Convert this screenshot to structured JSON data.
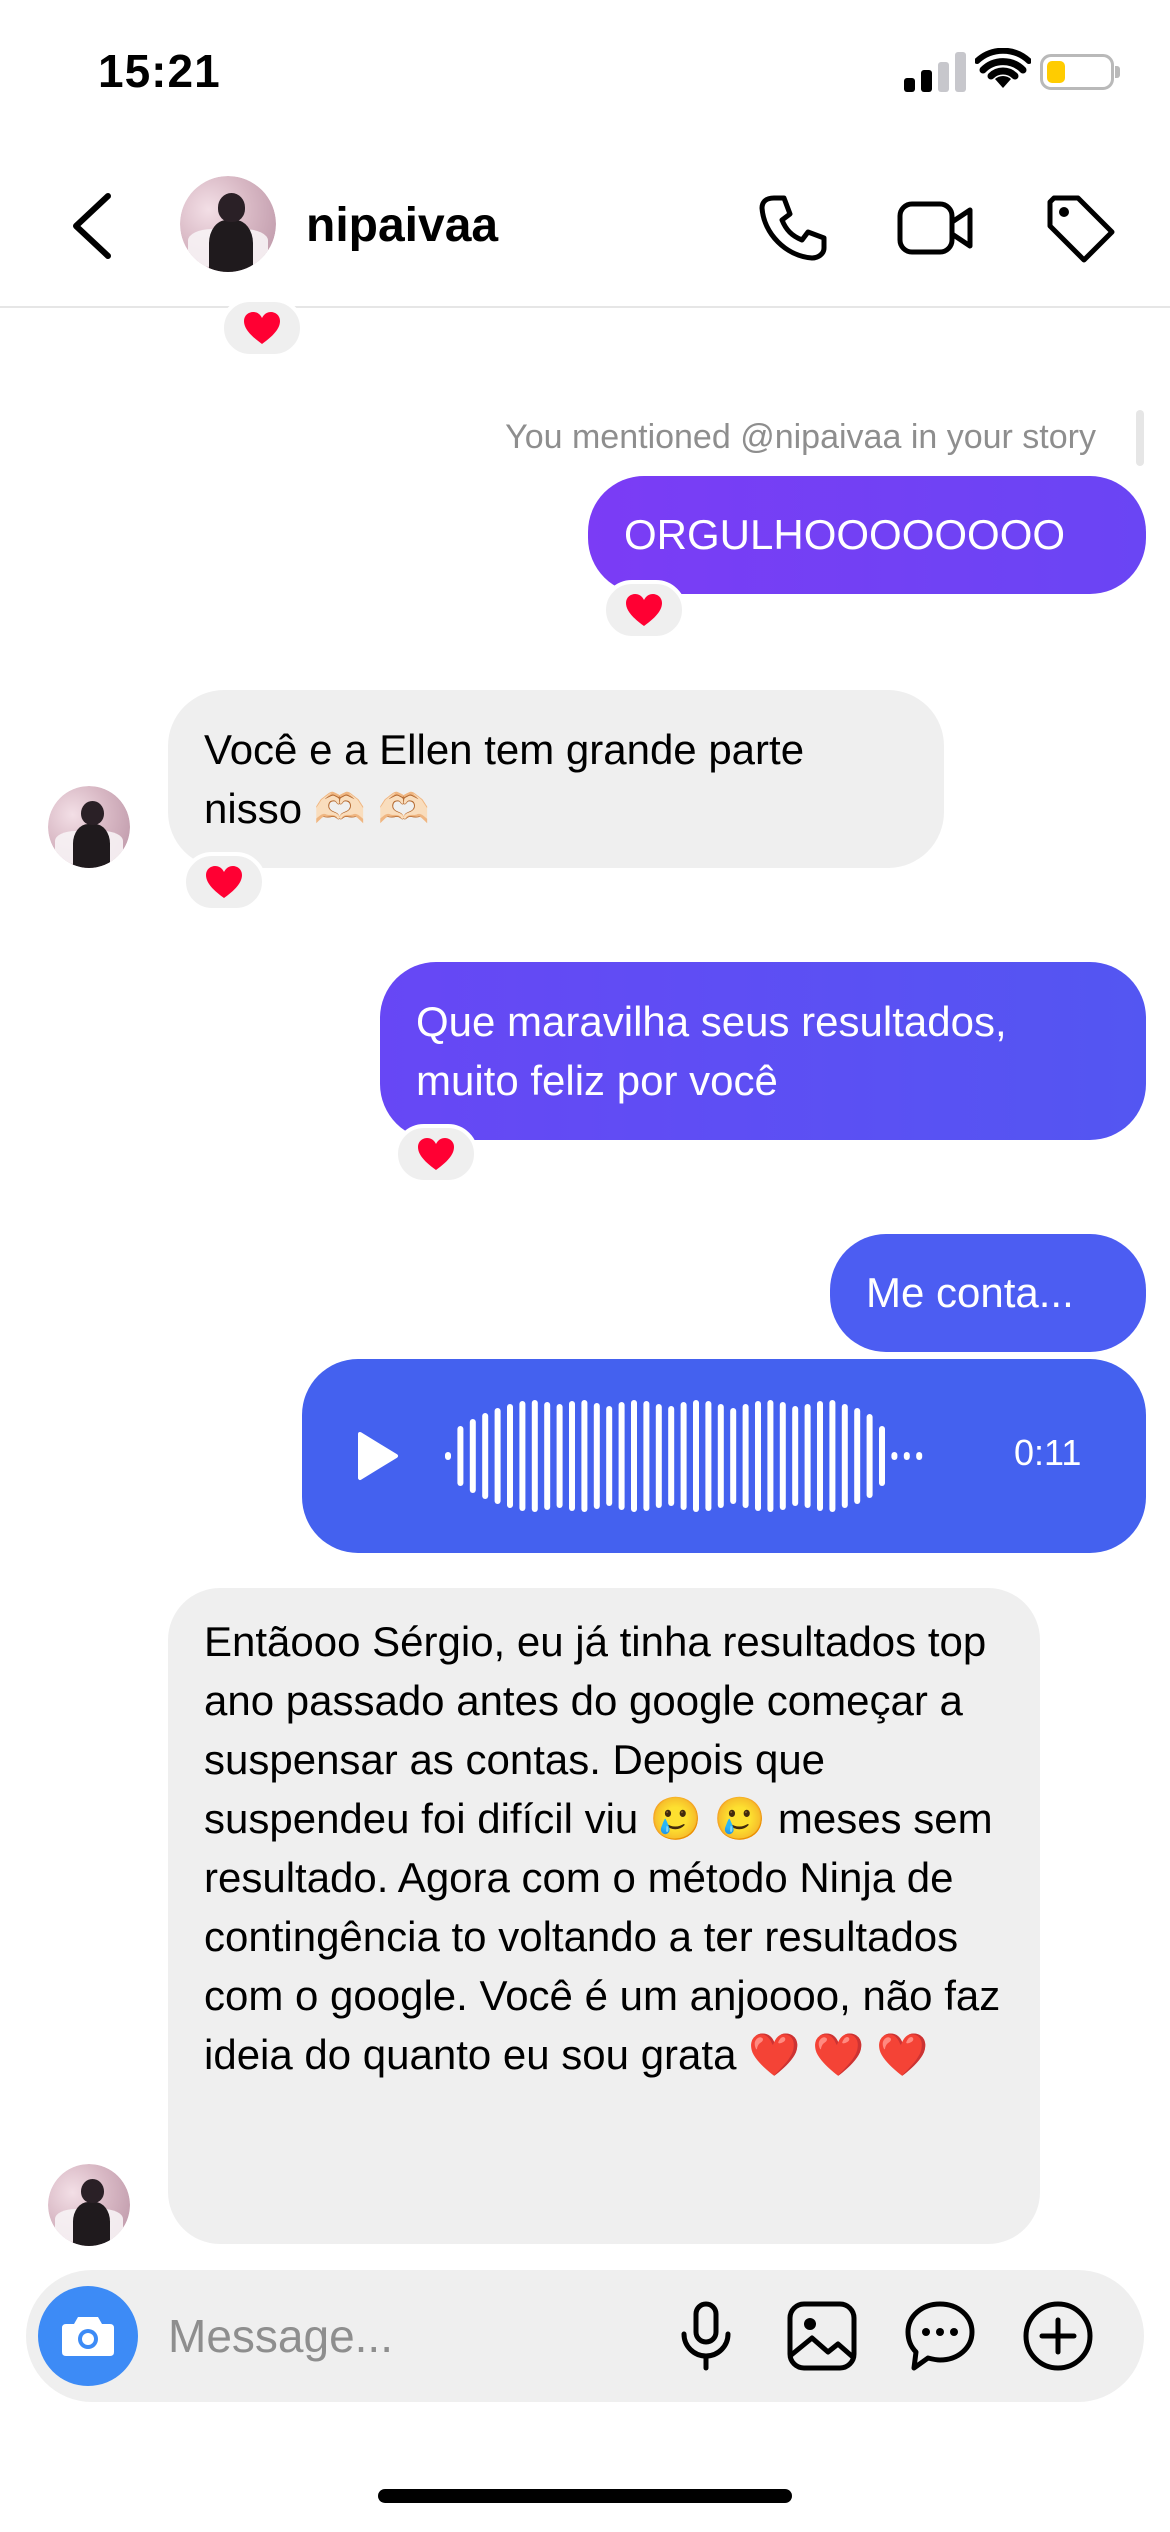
{
  "status_bar": {
    "time": "15:21"
  },
  "header": {
    "username": "nipaivaa"
  },
  "story_note": "You mentioned @nipaivaa in your story",
  "messages": {
    "m1": "ORGULHOOOOOOOO",
    "m2": "Você e a Ellen tem grande parte nisso 🫶🏻 🫶🏻",
    "m3": "Que maravilha seus resultados, muito feliz por você",
    "m4": "Me conta...",
    "m5": "Entãooo Sérgio, eu já tinha resultados top ano passado antes do google começar a suspensar as contas. Depois que suspendeu foi difícil viu 🥲 🥲  meses sem resultado. Agora com o método Ninja de contingência to voltando a ter resultados com o google. Você é um anjoooo, não faz ideia do quanto eu sou grata ❤️ ❤️ ❤️"
  },
  "voice_message": {
    "duration": "0:11"
  },
  "reaction_emoji": "❤️",
  "composer": {
    "placeholder": "Message..."
  },
  "colors": {
    "outgoing_gradient_start": "#7b3cf5",
    "outgoing_gradient_end": "#4c5ff2",
    "voice_bubble": "#4461ef",
    "incoming_bubble": "#efefef",
    "camera_button": "#3d8bf6",
    "battery_fill": "#ffcc00"
  },
  "icons": [
    "back-arrow-icon",
    "phone-icon",
    "video-camera-icon",
    "tag-icon",
    "heart-icon",
    "play-icon",
    "camera-icon",
    "microphone-icon",
    "gallery-icon",
    "sticker-icon",
    "plus-icon"
  ]
}
